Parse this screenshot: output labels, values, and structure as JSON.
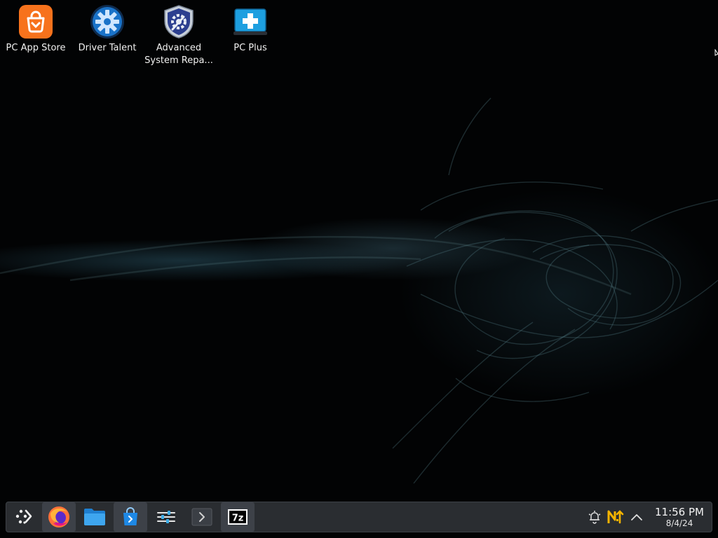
{
  "desktop": {
    "icons": [
      {
        "label": "PC App Store",
        "icon": "shopping-bag-icon"
      },
      {
        "label": "Driver Talent",
        "icon": "gear-icon"
      },
      {
        "label": "Advanced\nSystem Repa...",
        "icon": "shield-icon"
      },
      {
        "label": "PC Plus",
        "icon": "medical-plus-icon"
      }
    ]
  },
  "taskbar": {
    "launcher_icon": "app-launcher-icon",
    "apps": [
      {
        "icon": "firefox-icon"
      },
      {
        "icon": "folder-icon"
      },
      {
        "icon": "store-icon"
      },
      {
        "icon": "settings-sliders-icon"
      },
      {
        "icon": "terminal-icon"
      },
      {
        "icon": "7zip-icon",
        "text": "7z"
      }
    ],
    "tray": {
      "icons": [
        "notifications-icon",
        "update-icon",
        "expand-tray-icon"
      ],
      "time": "11:56 PM",
      "date": "8/4/24"
    }
  },
  "colors": {
    "taskbar_bg": "#2a2d31",
    "app_store_orange": "#f7721c",
    "driver_talent_blue": "#1a73c9",
    "wallpaper_teal": "#4f7780"
  }
}
